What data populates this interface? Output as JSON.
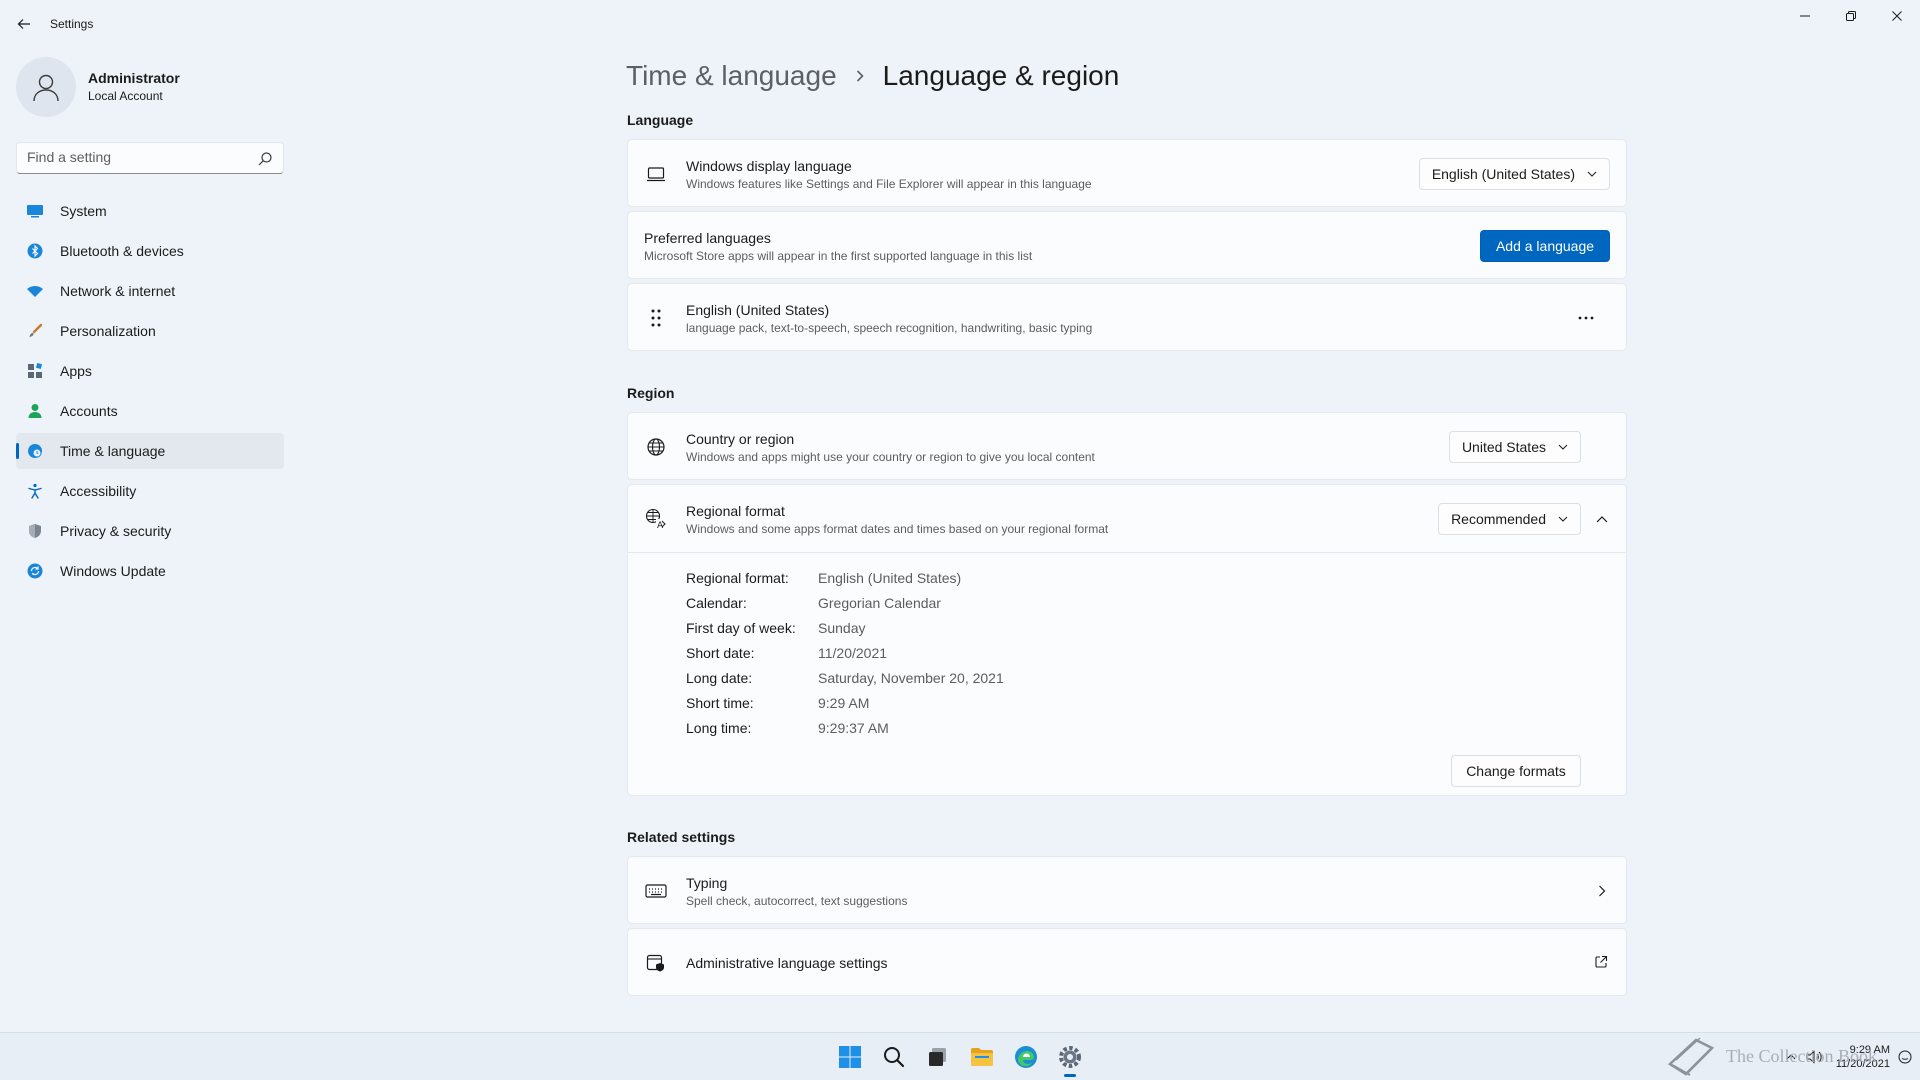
{
  "window": {
    "title": "Settings",
    "controls": [
      "minimize-icon",
      "restore-icon",
      "close-icon"
    ]
  },
  "profile": {
    "name": "Administrator",
    "account_type": "Local Account"
  },
  "search": {
    "placeholder": "Find a setting",
    "value": ""
  },
  "sidebar": {
    "items": [
      {
        "label": "System",
        "icon": "system-icon",
        "color": "#0078d4"
      },
      {
        "label": "Bluetooth & devices",
        "icon": "bluetooth-icon",
        "color": "#0078d4"
      },
      {
        "label": "Network & internet",
        "icon": "wifi-icon",
        "color": "#0078d4"
      },
      {
        "label": "Personalization",
        "icon": "brush-icon",
        "color": "#c25e12"
      },
      {
        "label": "Apps",
        "icon": "apps-icon",
        "color": "#5b6775"
      },
      {
        "label": "Accounts",
        "icon": "person-icon",
        "color": "#17a34a"
      },
      {
        "label": "Time & language",
        "icon": "globe-clock-icon",
        "color": "#0078d4",
        "active": true
      },
      {
        "label": "Accessibility",
        "icon": "accessibility-icon",
        "color": "#0067c0"
      },
      {
        "label": "Privacy & security",
        "icon": "shield-icon",
        "color": "#6b7280"
      },
      {
        "label": "Windows Update",
        "icon": "update-icon",
        "color": "#0078d4"
      }
    ]
  },
  "breadcrumb": {
    "parent": "Time & language",
    "current": "Language & region"
  },
  "language": {
    "section_title": "Language",
    "display_language": {
      "title": "Windows display language",
      "subtitle": "Windows features like Settings and File Explorer will appear in this language",
      "value": "English (United States)"
    },
    "preferred": {
      "title": "Preferred languages",
      "subtitle": "Microsoft Store apps will appear in the first supported language in this list",
      "button": "Add a language"
    },
    "installed": {
      "title": "English (United States)",
      "subtitle": "language pack, text-to-speech, speech recognition, handwriting, basic typing",
      "more": "..."
    }
  },
  "region": {
    "section_title": "Region",
    "country": {
      "title": "Country or region",
      "subtitle": "Windows and apps might use your country or region to give you local content",
      "value": "United States"
    },
    "format": {
      "title": "Regional format",
      "subtitle": "Windows and some apps format dates and times based on your regional format",
      "value": "Recommended",
      "details": [
        {
          "key": "Regional format:",
          "value": "English (United States)"
        },
        {
          "key": "Calendar:",
          "value": "Gregorian Calendar"
        },
        {
          "key": "First day of week:",
          "value": "Sunday"
        },
        {
          "key": "Short date:",
          "value": "11/20/2021"
        },
        {
          "key": "Long date:",
          "value": "Saturday, November 20, 2021"
        },
        {
          "key": "Short time:",
          "value": "9:29 AM"
        },
        {
          "key": "Long time:",
          "value": "9:29:37 AM"
        }
      ],
      "change_button": "Change formats"
    }
  },
  "related": {
    "section_title": "Related settings",
    "typing": {
      "title": "Typing",
      "subtitle": "Spell check, autocorrect, text suggestions"
    },
    "admin": {
      "title": "Administrative language settings"
    }
  },
  "taskbar": {
    "apps": [
      "windows-start-icon",
      "search-icon",
      "task-view-icon",
      "file-explorer-icon",
      "edge-icon",
      "settings-icon"
    ],
    "clock_time": "9:29 AM",
    "clock_date": "11/20/2021",
    "watermark": "The Collection Book"
  }
}
